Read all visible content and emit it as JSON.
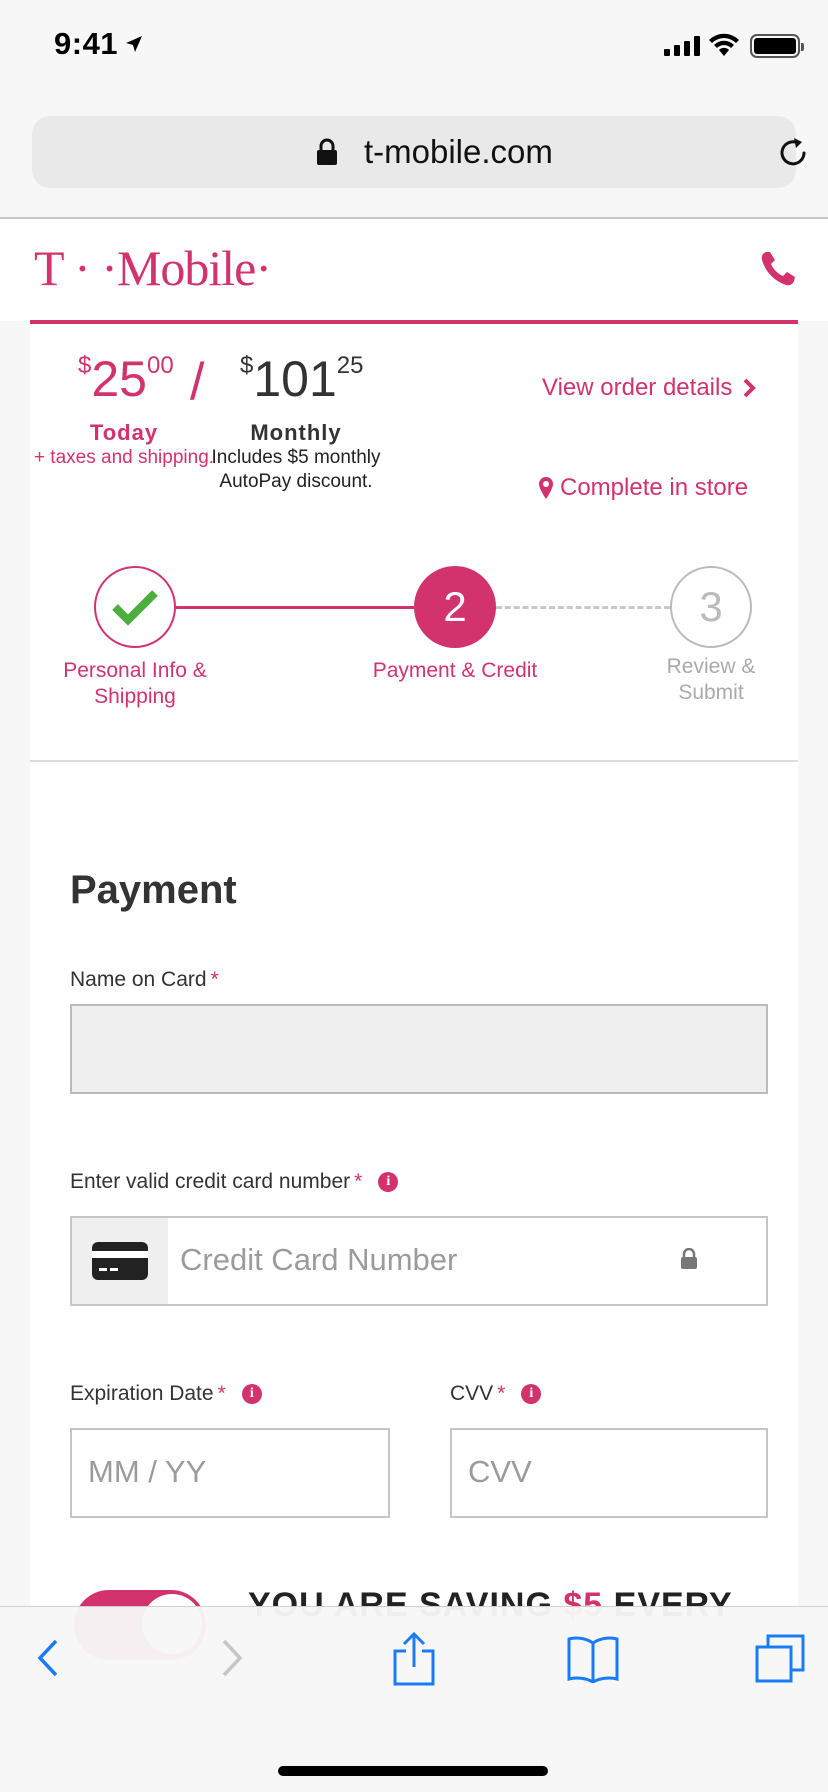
{
  "status_bar": {
    "time": "9:41"
  },
  "browser": {
    "url": "t-mobile.com"
  },
  "header": {
    "logo": "T · ·Mobile·"
  },
  "summary": {
    "today_price_dollars": "25",
    "today_price_cents": "00",
    "currency": "$",
    "separator": "/",
    "monthly_price_dollars": "101",
    "monthly_price_cents": "25",
    "today_label": "Today",
    "today_note": "+ taxes and shipping.",
    "monthly_label": "Monthly",
    "monthly_note": "Includes $5 monthly AutoPay discount.",
    "view_order_label": "View order details",
    "complete_store_label": "Complete in store"
  },
  "stepper": {
    "steps": [
      {
        "number": "",
        "label": "Personal Info & Shipping",
        "state": "complete"
      },
      {
        "number": "2",
        "label": "Payment & Credit",
        "state": "current"
      },
      {
        "number": "3",
        "label": "Review & Submit",
        "state": "upcoming"
      }
    ]
  },
  "payment": {
    "title": "Payment",
    "name_label": "Name on Card",
    "name_value": "",
    "cc_label": "Enter valid credit card number",
    "cc_placeholder": "Credit Card Number",
    "exp_label": "Expiration Date",
    "exp_placeholder": "MM / YY",
    "cvv_label": "CVV",
    "cvv_placeholder": "CVV",
    "required_mark": "*"
  },
  "autopay": {
    "enabled": true,
    "text_prefix": "YOU ARE SAVING ",
    "amount": "$5",
    "text_suffix": " EVERY"
  },
  "colors": {
    "brand": "#d2336d",
    "success": "#4cae3f",
    "ios_blue": "#1a7cf5"
  },
  "toolbar": {
    "icons": [
      "back-icon",
      "forward-icon",
      "share-icon",
      "bookmarks-icon",
      "tabs-icon"
    ]
  }
}
